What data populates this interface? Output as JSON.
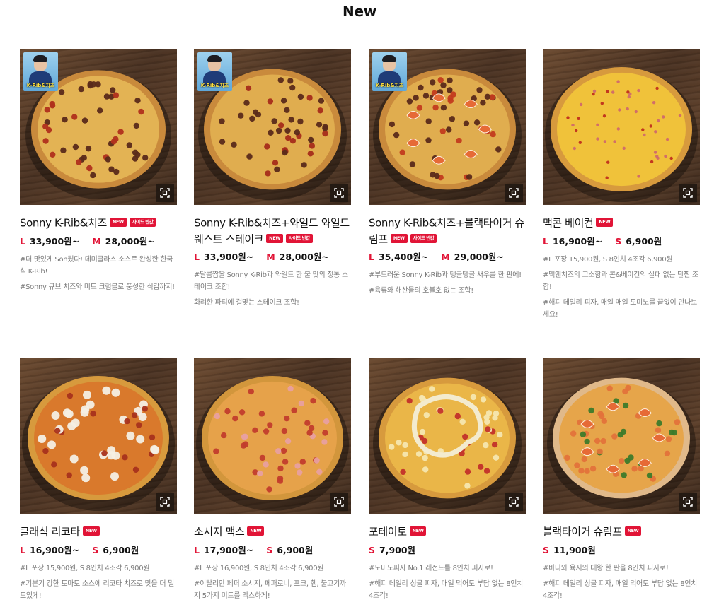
{
  "section_title": "New",
  "icons": {
    "zoom": "zoom-expand-icon"
  },
  "colors": {
    "accent": "#e11436",
    "text": "#111111",
    "muted": "#7b7b7b"
  },
  "products": [
    {
      "name": "Sonny K-Rib&치즈",
      "badges": [
        "NEW",
        "사이드 반값"
      ],
      "promo_label": "K-Rib&치즈",
      "prices": [
        {
          "size": "L",
          "price": "33,900원~"
        },
        {
          "size": "M",
          "price": "28,000원~"
        }
      ],
      "descriptions": [
        "#더 맛있게 Son뭤다! 데미글라스 소스로 완성한 한국식 K-Rib!",
        "#Sonny 큐브 치즈와 미트 크럼블로 풍성한 식감까지!"
      ]
    },
    {
      "name": "Sonny K-Rib&치즈+와일드 와일드 웨스트 스테이크",
      "badges": [
        "NEW",
        "사이드 반값"
      ],
      "promo_label": "K-Rib&치즈",
      "prices": [
        {
          "size": "L",
          "price": "33,900원~"
        },
        {
          "size": "M",
          "price": "28,000원~"
        }
      ],
      "descriptions": [
        "#달콤짭짤 Sonny K-Rib과 와일드 한 불 맛의 정통 스테이크 조합!",
        "화려한 파티에 걸맞는 스테이크 조합!"
      ]
    },
    {
      "name": "Sonny K-Rib&치즈+블랙타이거 슈림프",
      "badges": [
        "NEW",
        "사이드 반값"
      ],
      "promo_label": "K-Rib&치즈",
      "prices": [
        {
          "size": "L",
          "price": "35,400원~"
        },
        {
          "size": "M",
          "price": "29,000원~"
        }
      ],
      "descriptions": [
        "#부드러운 Sonny K-Rib과 탱글탱글 새우를 한 판에!",
        "#육류와 해산물의 호불호 없는 조합!"
      ]
    },
    {
      "name": "맥콘 베이컨",
      "badges": [
        "NEW"
      ],
      "promo_label": "",
      "prices": [
        {
          "size": "L",
          "price": "16,900원~"
        },
        {
          "size": "S",
          "price": "6,900원"
        }
      ],
      "descriptions": [
        "#L 포장 15,900원, S 8인치 4조각 6,900원",
        "#맥앤치즈의 고소함과 콘&베이컨의 실패 없는 단짠 조합!",
        "#해피 데일리 피자, 매일 매일 도미노를 끝없이 만나보세요!"
      ]
    },
    {
      "name": "클래식 리코타",
      "badges": [
        "NEW"
      ],
      "promo_label": "",
      "prices": [
        {
          "size": "L",
          "price": "16,900원~"
        },
        {
          "size": "S",
          "price": "6,900원"
        }
      ],
      "descriptions": [
        "#L 포장 15,900원, S 8인치 4조각 6,900원",
        "#기본기 강한 토마토 소스에 리코타 치즈로 맛을 더 밀도있게!"
      ]
    },
    {
      "name": "소시지 맥스",
      "badges": [
        "NEW"
      ],
      "promo_label": "",
      "prices": [
        {
          "size": "L",
          "price": "17,900원~"
        },
        {
          "size": "S",
          "price": "6,900원"
        }
      ],
      "descriptions": [
        "#L 포장 16,900원, S 8인치 4조각 6,900원",
        "#이탈리안 페퍼 소시지, 페퍼로니, 포크, 햄, 불고기까지 5가지 미트를 맥스하게!"
      ]
    },
    {
      "name": "포테이토",
      "badges": [
        "NEW"
      ],
      "promo_label": "",
      "prices": [
        {
          "size": "S",
          "price": "7,900원"
        }
      ],
      "descriptions": [
        "#도미노피자 No.1 레전드를 8인치 피자로!",
        "#해피 데일리 싱글 피자, 매일 먹어도 부담 없는 8인치 4조각!"
      ]
    },
    {
      "name": "블랙타이거 슈림프",
      "badges": [
        "NEW"
      ],
      "promo_label": "",
      "prices": [
        {
          "size": "S",
          "price": "11,900원"
        }
      ],
      "descriptions": [
        "#바다와 육지의 대왕 한 판을 8인치 피자로!",
        "#해피 데일리 싱글 피자, 매일 먹어도 부담 없는 8인치 4조각!"
      ]
    }
  ]
}
